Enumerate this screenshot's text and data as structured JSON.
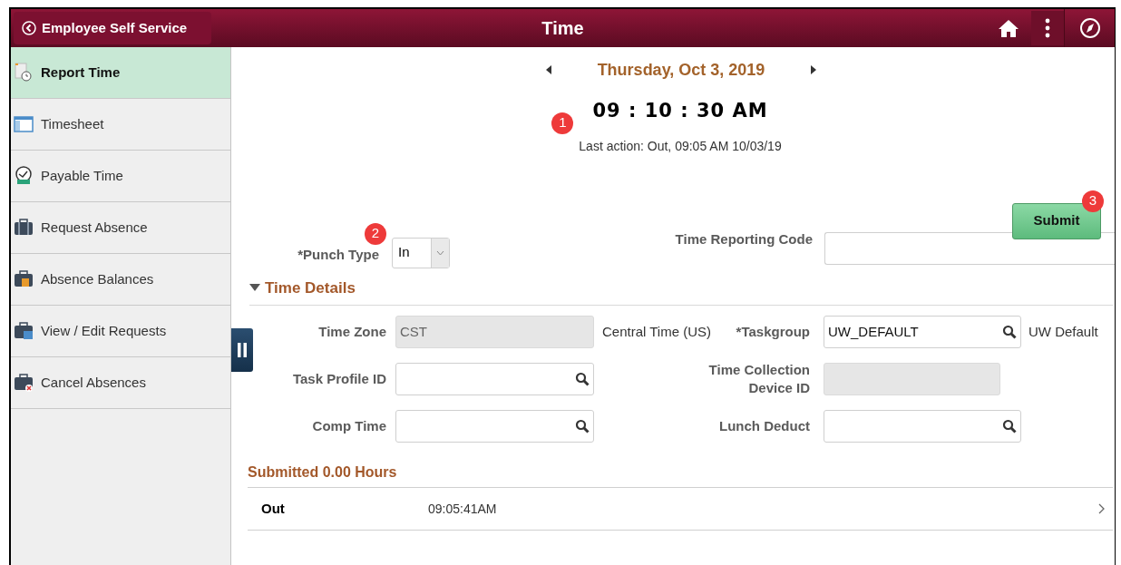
{
  "header": {
    "back_button": "Employee Self Service",
    "title": "Time"
  },
  "sidebar": {
    "items": [
      {
        "label": "Report Time",
        "selected": true
      },
      {
        "label": "Timesheet",
        "selected": false
      },
      {
        "label": "Payable Time",
        "selected": false
      },
      {
        "label": "Request Absence",
        "selected": false
      },
      {
        "label": "Absence Balances",
        "selected": false
      },
      {
        "label": "View / Edit Requests",
        "selected": false
      },
      {
        "label": "Cancel Absences",
        "selected": false
      }
    ]
  },
  "date": "Thursday, Oct 3, 2019",
  "clock": "09 : 10 : 30 AM",
  "last_action": {
    "text": "Last action: Out, 09:05 AM 10/03/19",
    "callout": "1"
  },
  "submit": {
    "label": "Submit",
    "callout": "3"
  },
  "punch_type": {
    "label": "*Punch Type",
    "value": "In",
    "callout": "2"
  },
  "time_reporting_code": {
    "label": "Time Reporting Code"
  },
  "time_details": {
    "title": "Time Details",
    "expanded": true,
    "rows": [
      {
        "left": {
          "label": "Time Zone",
          "kind": "display",
          "value": "CST"
        },
        "description": "Central Time (US)",
        "right": {
          "label": "*Taskgroup",
          "kind": "lookup",
          "value": "UW_DEFAULT"
        },
        "right_description": "UW Default"
      },
      {
        "left": {
          "label": "Task Profile ID",
          "kind": "lookup"
        },
        "right": {
          "label": "Time Collection Device ID",
          "kind": "display"
        }
      },
      {
        "left": {
          "label": "Comp Time",
          "kind": "lookup"
        },
        "right": {
          "label": "Lunch Deduct",
          "kind": "lookup"
        }
      }
    ]
  },
  "submitted": {
    "title": "Submitted 0.00 Hours",
    "rows": [
      {
        "type": "Out",
        "time": "09:05:41AM"
      }
    ]
  }
}
